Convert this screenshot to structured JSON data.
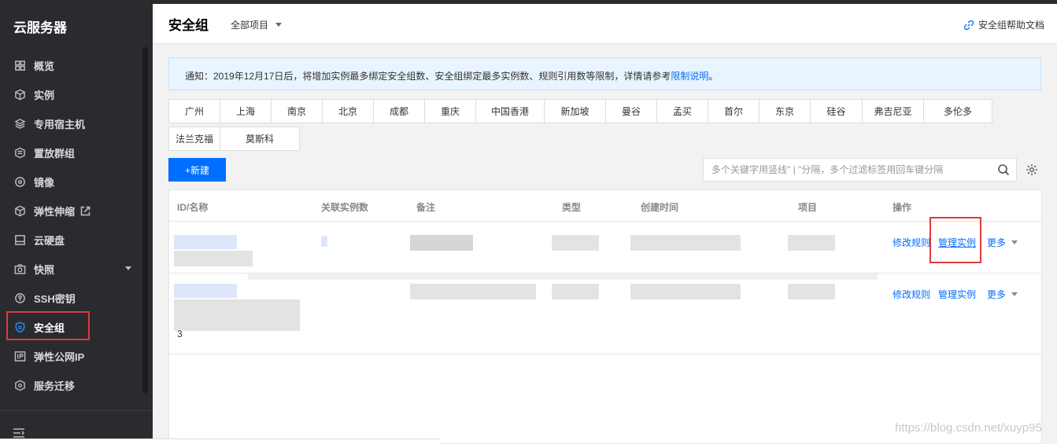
{
  "sidebar": {
    "title": "云服务器",
    "items": [
      {
        "label": "概览",
        "icon": "grid-icon"
      },
      {
        "label": "实例",
        "icon": "cube-icon"
      },
      {
        "label": "专用宿主机",
        "icon": "layers-icon"
      },
      {
        "label": "置放群组",
        "icon": "cluster-icon"
      },
      {
        "label": "镜像",
        "icon": "disc-icon"
      },
      {
        "label": "弹性伸缩",
        "icon": "scaling-cube-icon"
      },
      {
        "label": "云硬盘",
        "icon": "disk-icon"
      },
      {
        "label": "快照",
        "icon": "camera-icon"
      },
      {
        "label": "SSH密钥",
        "icon": "key-icon"
      },
      {
        "label": "安全组",
        "icon": "shield-icon"
      },
      {
        "label": "弹性公网IP",
        "icon": "ip-icon"
      },
      {
        "label": "服务迁移",
        "icon": "migrate-icon"
      }
    ],
    "active": "安全组"
  },
  "header": {
    "title": "安全组",
    "project_select": "全部项目",
    "help_link": "安全组帮助文档"
  },
  "notice": {
    "text": "通知：2019年12月17日后，将增加实例最多绑定安全组数、安全组绑定最多实例数、规则引用数等限制，详情请参考",
    "link": "限制说明",
    "suffix": "。"
  },
  "regions": [
    "广州",
    "上海",
    "南京",
    "北京",
    "成都",
    "重庆",
    "中国香港",
    "新加坡",
    "曼谷",
    "孟买",
    "首尔",
    "东京",
    "硅谷",
    "弗吉尼亚",
    "多伦多",
    "法兰克福",
    "莫斯科"
  ],
  "toolbar": {
    "new_button": "+新建",
    "search_placeholder": "多个关键字用竖线\" | \"分隔，多个过滤标签用回车键分隔"
  },
  "table": {
    "columns": [
      "ID/名称",
      "关联实例数",
      "备注",
      "类型",
      "创建时间",
      "项目",
      "操作"
    ],
    "rows": [
      {
        "actions": [
          "修改规则",
          "管理实例",
          "更多"
        ]
      },
      {
        "actions": [
          "修改规则",
          "管理实例",
          "更多"
        ]
      }
    ],
    "stray_text": "3"
  },
  "watermark": "https://blog.csdn.net/xuyp95",
  "colors": {
    "accent": "#006eff",
    "sidebar_bg": "#292b2f",
    "highlight": "#e23a3a"
  }
}
